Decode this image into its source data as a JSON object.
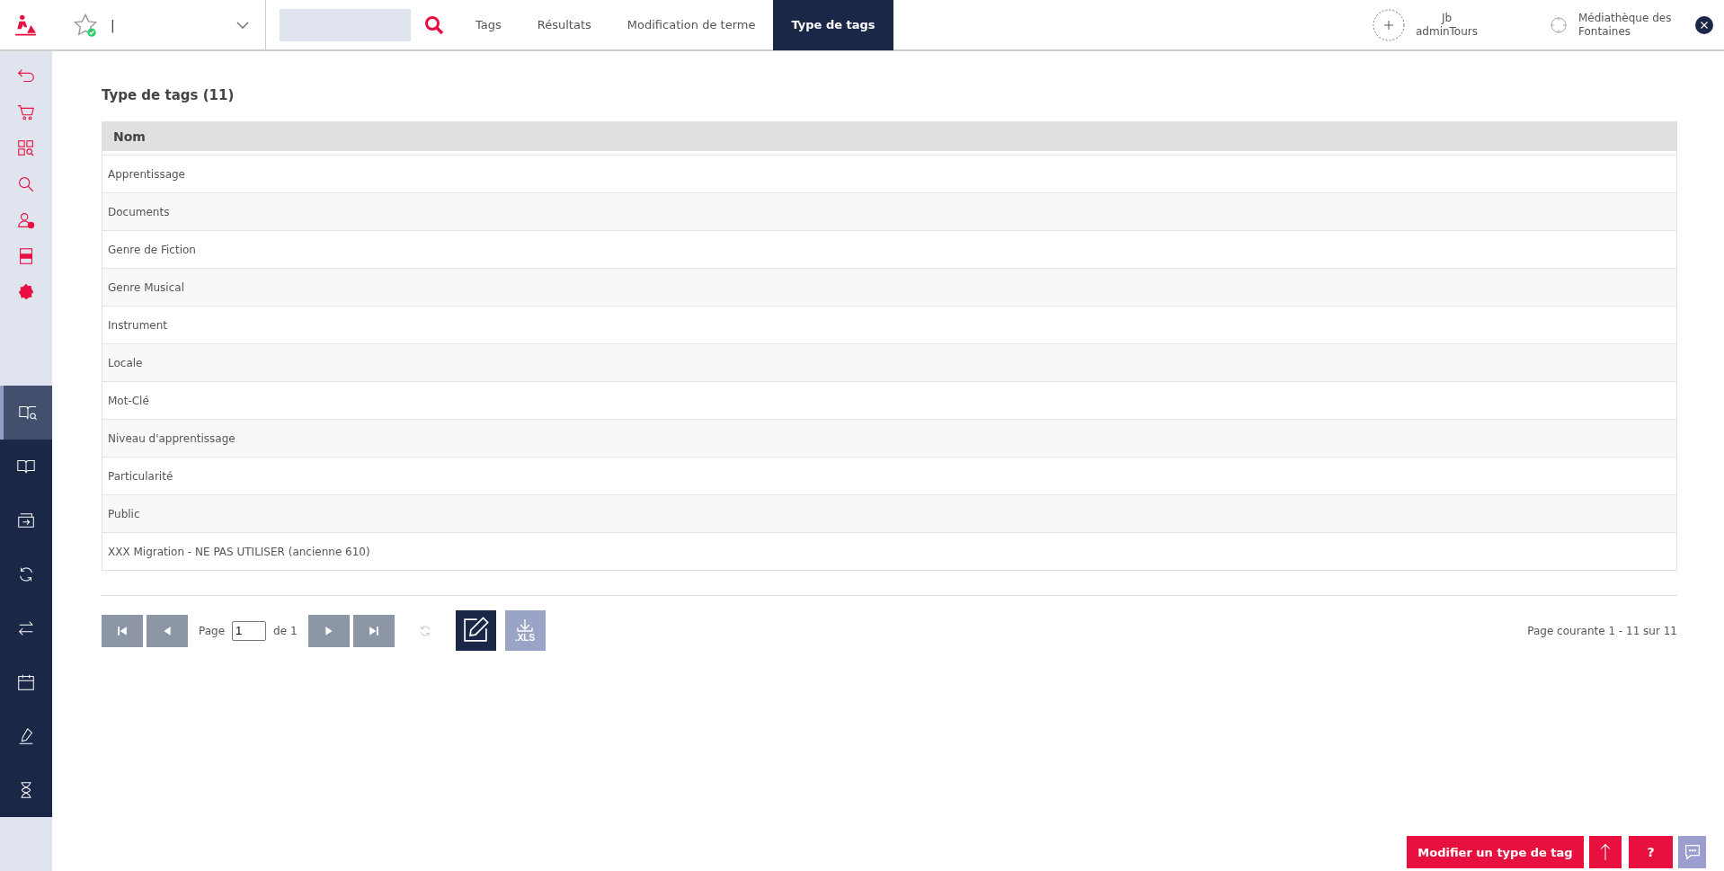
{
  "header": {
    "favorite_value": "|",
    "tabs": [
      {
        "label": "Tags",
        "selected": false
      },
      {
        "label": "Résultats",
        "selected": false
      },
      {
        "label": "Modification de terme",
        "selected": false
      },
      {
        "label": "Type de tags",
        "selected": true
      }
    ],
    "user": {
      "first": "Jb",
      "second": "adminTours"
    },
    "library": "Médiathèque des Fontaines"
  },
  "sidebar": {
    "nav_items": [
      {
        "selected": true
      },
      {
        "selected": false
      },
      {
        "selected": false
      },
      {
        "selected": false
      },
      {
        "selected": false
      },
      {
        "selected": false
      },
      {
        "selected": false
      },
      {
        "selected": false
      }
    ]
  },
  "title": "Type de tags (11)",
  "table": {
    "columns": [
      "Nom"
    ],
    "rows": [
      "Apprentissage",
      "Documents",
      "Genre de Fiction",
      "Genre Musical",
      "Instrument",
      "Locale",
      "Mot-Clé",
      "Niveau d'apprentissage",
      "Particularité",
      "Public",
      "XXX Migration - NE PAS UTILISER (ancienne 610)"
    ]
  },
  "pagination": {
    "page_label": "Page",
    "page_value": "1",
    "of_label": "de 1",
    "xls_label": ".XLS",
    "summary": "Page courante 1 - 11 sur 11"
  },
  "footer_buttons": {
    "primary": "Modifier un type de tag",
    "help": "?"
  }
}
